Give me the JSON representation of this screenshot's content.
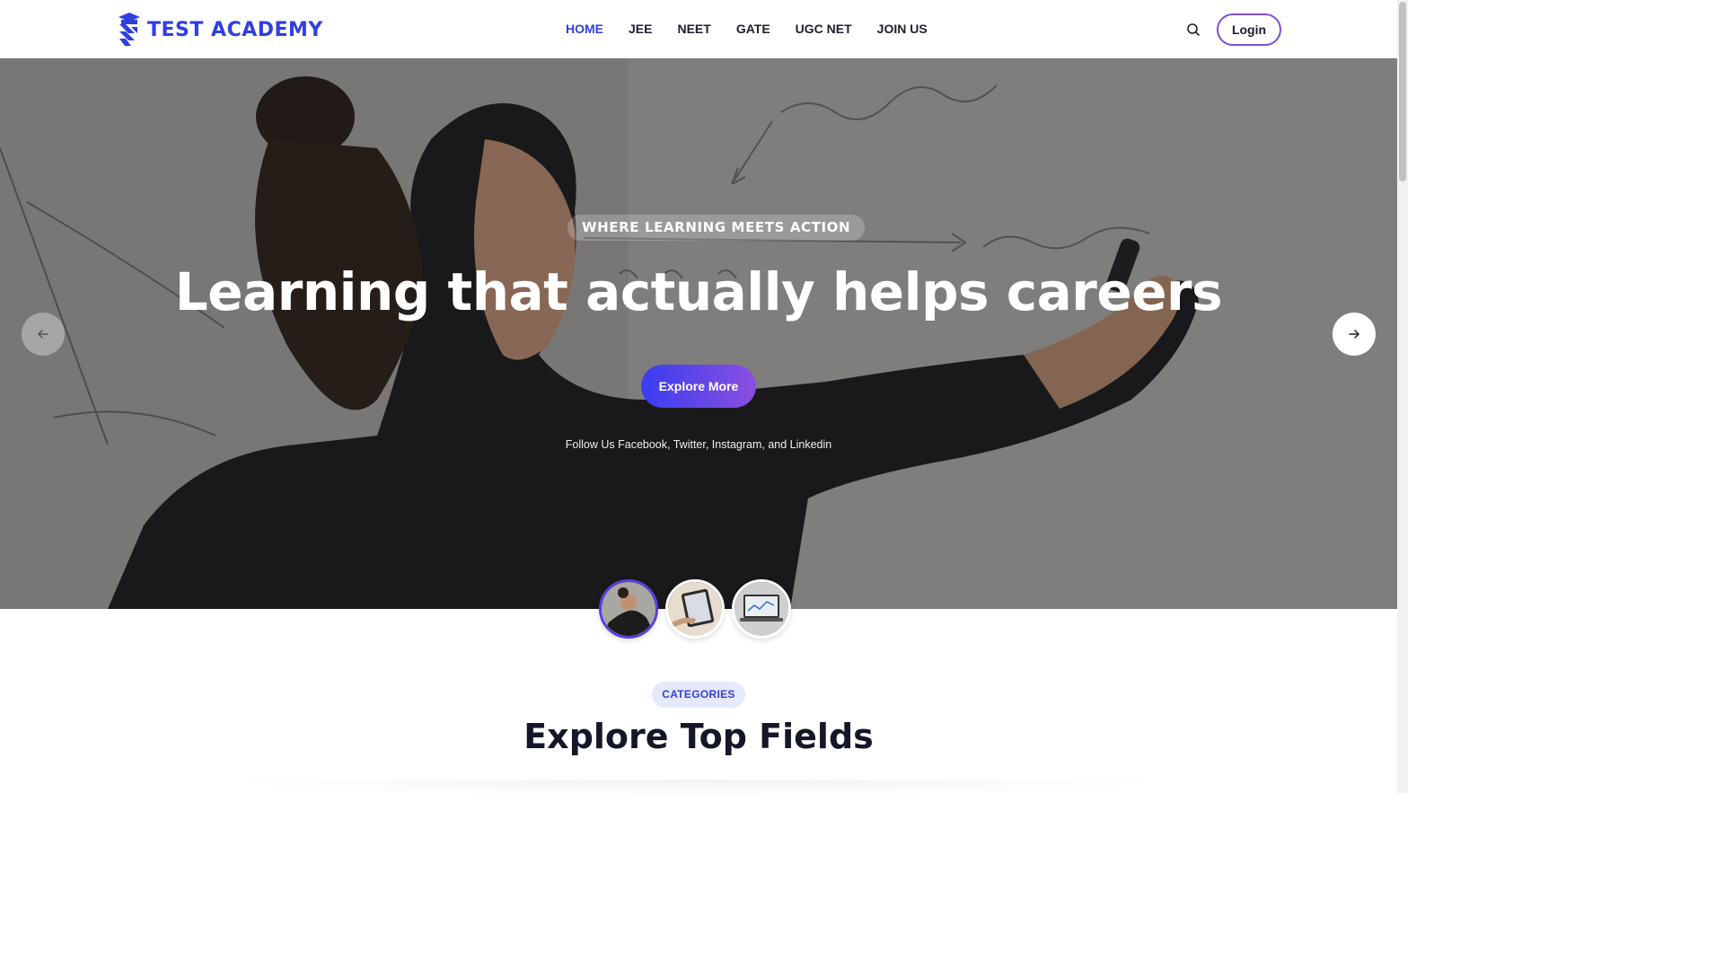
{
  "brand": {
    "name": "TEST ACADEMY",
    "accent": "#2f3fe0"
  },
  "nav": {
    "items": [
      {
        "label": "HOME",
        "active": true
      },
      {
        "label": "JEE",
        "active": false
      },
      {
        "label": "NEET",
        "active": false
      },
      {
        "label": "GATE",
        "active": false
      },
      {
        "label": "UGC NET",
        "active": false
      },
      {
        "label": "JOIN US",
        "active": false
      }
    ],
    "search_icon": "search-icon",
    "login_label": "Login"
  },
  "hero": {
    "tagline": "WHERE LEARNING MEETS ACTION",
    "title": "Learning that actually helps careers",
    "cta_label": "Explore More",
    "follow_text": "Follow Us Facebook, Twitter, Instagram, and Linkedin",
    "prev_icon": "arrow-left-icon",
    "next_icon": "arrow-right-icon",
    "slides_count": 3,
    "active_slide": 1
  },
  "categories": {
    "badge": "CATEGORIES",
    "title": "Explore Top Fields"
  },
  "colors": {
    "gradient_start": "#3a3df0",
    "gradient_end": "#8a4fe0",
    "badge_bg": "#e6e9fb"
  }
}
